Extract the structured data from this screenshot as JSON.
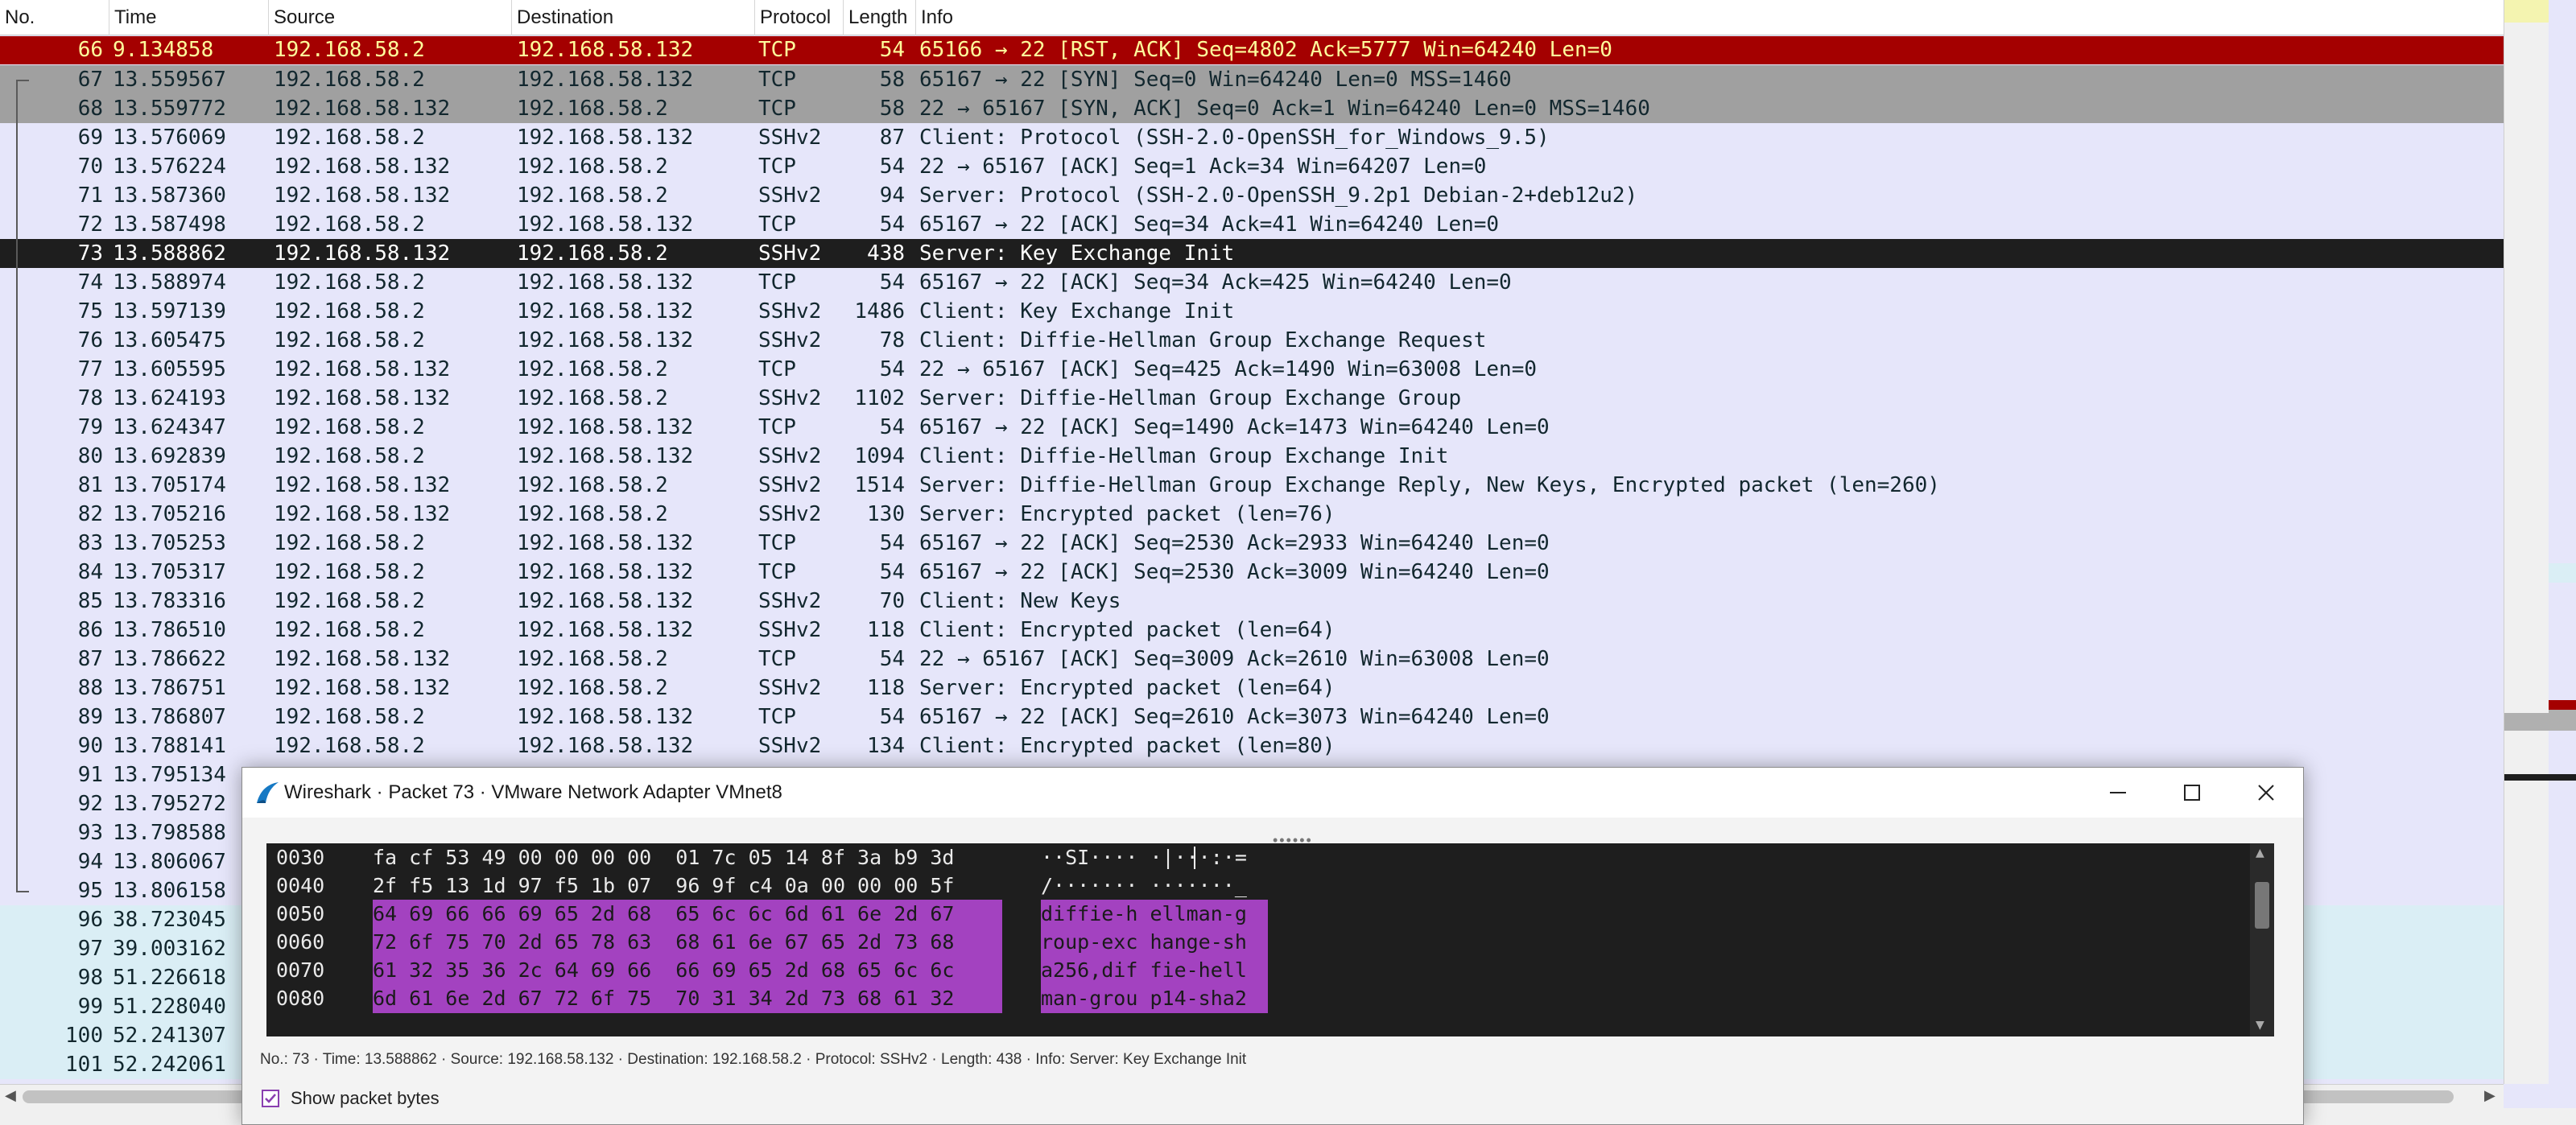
{
  "columns": [
    "No.",
    "Time",
    "Source",
    "Destination",
    "Protocol",
    "Length",
    "Info"
  ],
  "colors": {
    "row_default": "#e6e6fa",
    "row_rst": "#a40000",
    "row_syn": "#a0a0a0",
    "row_selected": "#1e1e1e",
    "row_later": "#daeef5",
    "hex_highlight": "#a342c0"
  },
  "packets": [
    {
      "no": "66",
      "time": "9.134858",
      "src": "192.168.58.2",
      "dst": "192.168.58.132",
      "proto": "TCP",
      "len": "54",
      "info": "65166 → 22 [RST, ACK] Seq=4802 Ack=5777 Win=64240 Len=0",
      "style": "rst"
    },
    {
      "no": "67",
      "time": "13.559567",
      "src": "192.168.58.2",
      "dst": "192.168.58.132",
      "proto": "TCP",
      "len": "58",
      "info": "65167 → 22 [SYN] Seq=0 Win=64240 Len=0 MSS=1460",
      "style": "syn"
    },
    {
      "no": "68",
      "time": "13.559772",
      "src": "192.168.58.132",
      "dst": "192.168.58.2",
      "proto": "TCP",
      "len": "58",
      "info": "22 → 65167 [SYN, ACK] Seq=0 Ack=1 Win=64240 Len=0 MSS=1460",
      "style": "syn"
    },
    {
      "no": "69",
      "time": "13.576069",
      "src": "192.168.58.2",
      "dst": "192.168.58.132",
      "proto": "SSHv2",
      "len": "87",
      "info": "Client: Protocol (SSH-2.0-OpenSSH_for_Windows_9.5)",
      "style": "normal"
    },
    {
      "no": "70",
      "time": "13.576224",
      "src": "192.168.58.132",
      "dst": "192.168.58.2",
      "proto": "TCP",
      "len": "54",
      "info": "22 → 65167 [ACK] Seq=1 Ack=34 Win=64207 Len=0",
      "style": "normal"
    },
    {
      "no": "71",
      "time": "13.587360",
      "src": "192.168.58.132",
      "dst": "192.168.58.2",
      "proto": "SSHv2",
      "len": "94",
      "info": "Server: Protocol (SSH-2.0-OpenSSH_9.2p1 Debian-2+deb12u2)",
      "style": "normal"
    },
    {
      "no": "72",
      "time": "13.587498",
      "src": "192.168.58.2",
      "dst": "192.168.58.132",
      "proto": "TCP",
      "len": "54",
      "info": "65167 → 22 [ACK] Seq=34 Ack=41 Win=64240 Len=0",
      "style": "normal"
    },
    {
      "no": "73",
      "time": "13.588862",
      "src": "192.168.58.132",
      "dst": "192.168.58.2",
      "proto": "SSHv2",
      "len": "438",
      "info": "Server: Key Exchange Init",
      "style": "selected"
    },
    {
      "no": "74",
      "time": "13.588974",
      "src": "192.168.58.2",
      "dst": "192.168.58.132",
      "proto": "TCP",
      "len": "54",
      "info": "65167 → 22 [ACK] Seq=34 Ack=425 Win=64240 Len=0",
      "style": "normal"
    },
    {
      "no": "75",
      "time": "13.597139",
      "src": "192.168.58.2",
      "dst": "192.168.58.132",
      "proto": "SSHv2",
      "len": "1486",
      "info": "Client: Key Exchange Init",
      "style": "normal"
    },
    {
      "no": "76",
      "time": "13.605475",
      "src": "192.168.58.2",
      "dst": "192.168.58.132",
      "proto": "SSHv2",
      "len": "78",
      "info": "Client: Diffie-Hellman Group Exchange Request",
      "style": "normal"
    },
    {
      "no": "77",
      "time": "13.605595",
      "src": "192.168.58.132",
      "dst": "192.168.58.2",
      "proto": "TCP",
      "len": "54",
      "info": "22 → 65167 [ACK] Seq=425 Ack=1490 Win=63008 Len=0",
      "style": "normal"
    },
    {
      "no": "78",
      "time": "13.624193",
      "src": "192.168.58.132",
      "dst": "192.168.58.2",
      "proto": "SSHv2",
      "len": "1102",
      "info": "Server: Diffie-Hellman Group Exchange Group",
      "style": "normal"
    },
    {
      "no": "79",
      "time": "13.624347",
      "src": "192.168.58.2",
      "dst": "192.168.58.132",
      "proto": "TCP",
      "len": "54",
      "info": "65167 → 22 [ACK] Seq=1490 Ack=1473 Win=64240 Len=0",
      "style": "normal"
    },
    {
      "no": "80",
      "time": "13.692839",
      "src": "192.168.58.2",
      "dst": "192.168.58.132",
      "proto": "SSHv2",
      "len": "1094",
      "info": "Client: Diffie-Hellman Group Exchange Init",
      "style": "normal"
    },
    {
      "no": "81",
      "time": "13.705174",
      "src": "192.168.58.132",
      "dst": "192.168.58.2",
      "proto": "SSHv2",
      "len": "1514",
      "info": "Server: Diffie-Hellman Group Exchange Reply, New Keys, Encrypted packet (len=260)",
      "style": "normal"
    },
    {
      "no": "82",
      "time": "13.705216",
      "src": "192.168.58.132",
      "dst": "192.168.58.2",
      "proto": "SSHv2",
      "len": "130",
      "info": "Server: Encrypted packet (len=76)",
      "style": "normal"
    },
    {
      "no": "83",
      "time": "13.705253",
      "src": "192.168.58.2",
      "dst": "192.168.58.132",
      "proto": "TCP",
      "len": "54",
      "info": "65167 → 22 [ACK] Seq=2530 Ack=2933 Win=64240 Len=0",
      "style": "normal"
    },
    {
      "no": "84",
      "time": "13.705317",
      "src": "192.168.58.2",
      "dst": "192.168.58.132",
      "proto": "TCP",
      "len": "54",
      "info": "65167 → 22 [ACK] Seq=2530 Ack=3009 Win=64240 Len=0",
      "style": "normal"
    },
    {
      "no": "85",
      "time": "13.783316",
      "src": "192.168.58.2",
      "dst": "192.168.58.132",
      "proto": "SSHv2",
      "len": "70",
      "info": "Client: New Keys",
      "style": "normal"
    },
    {
      "no": "86",
      "time": "13.786510",
      "src": "192.168.58.2",
      "dst": "192.168.58.132",
      "proto": "SSHv2",
      "len": "118",
      "info": "Client: Encrypted packet (len=64)",
      "style": "normal"
    },
    {
      "no": "87",
      "time": "13.786622",
      "src": "192.168.58.132",
      "dst": "192.168.58.2",
      "proto": "TCP",
      "len": "54",
      "info": "22 → 65167 [ACK] Seq=3009 Ack=2610 Win=63008 Len=0",
      "style": "normal"
    },
    {
      "no": "88",
      "time": "13.786751",
      "src": "192.168.58.132",
      "dst": "192.168.58.2",
      "proto": "SSHv2",
      "len": "118",
      "info": "Server: Encrypted packet (len=64)",
      "style": "normal"
    },
    {
      "no": "89",
      "time": "13.786807",
      "src": "192.168.58.2",
      "dst": "192.168.58.132",
      "proto": "TCP",
      "len": "54",
      "info": "65167 → 22 [ACK] Seq=2610 Ack=3073 Win=64240 Len=0",
      "style": "normal"
    },
    {
      "no": "90",
      "time": "13.788141",
      "src": "192.168.58.2",
      "dst": "192.168.58.132",
      "proto": "SSHv2",
      "len": "134",
      "info": "Client: Encrypted packet (len=80)",
      "style": "normal"
    },
    {
      "no": "91",
      "time": "13.795134",
      "src": "",
      "dst": "",
      "proto": "",
      "len": "",
      "info": "",
      "style": "normal"
    },
    {
      "no": "92",
      "time": "13.795272",
      "src": "",
      "dst": "",
      "proto": "",
      "len": "",
      "info": "",
      "style": "normal"
    },
    {
      "no": "93",
      "time": "13.798588",
      "src": "",
      "dst": "",
      "proto": "",
      "len": "",
      "info": "",
      "style": "normal"
    },
    {
      "no": "94",
      "time": "13.806067",
      "src": "",
      "dst": "",
      "proto": "",
      "len": "",
      "info": "",
      "style": "normal"
    },
    {
      "no": "95",
      "time": "13.806158",
      "src": "",
      "dst": "",
      "proto": "",
      "len": "",
      "info": "",
      "style": "normal"
    },
    {
      "no": "96",
      "time": "38.723045",
      "src": "",
      "dst": "",
      "proto": "",
      "len": "",
      "info": "",
      "style": "later"
    },
    {
      "no": "97",
      "time": "39.003162",
      "src": "",
      "dst": "",
      "proto": "",
      "len": "",
      "info": "",
      "style": "later"
    },
    {
      "no": "98",
      "time": "51.226618",
      "src": "",
      "dst": "",
      "proto": "",
      "len": "",
      "info": "",
      "style": "later"
    },
    {
      "no": "99",
      "time": "51.228040",
      "src": "",
      "dst": "",
      "proto": "",
      "len": "",
      "info": "",
      "style": "later"
    },
    {
      "no": "100",
      "time": "52.241307",
      "src": "",
      "dst": "",
      "proto": "",
      "len": "",
      "info": "",
      "style": "later"
    },
    {
      "no": "101",
      "time": "52.242061",
      "src": "",
      "dst": "",
      "proto": "",
      "len": "",
      "info": "",
      "style": "later"
    }
  ],
  "popup": {
    "title": "Wireshark · Packet 73 · VMware Network Adapter VMnet8",
    "status": "No.: 73 · Time: 13.588862 · Source: 192.168.58.132 · Destination: 192.168.58.2 · Protocol: SSHv2 · Length: 438 · Info: Server: Key Exchange Init",
    "show_bytes_label": "Show packet bytes",
    "show_bytes_checked": true,
    "hex_rows": [
      {
        "offset": "0030",
        "bytes": "fa cf 53 49 00 00 00 00  01 7c 05 14 8f 3a b9 3d",
        "ascii": "··SI···· ·|···:·=",
        "selected": false
      },
      {
        "offset": "0040",
        "bytes": "2f f5 13 1d 97 f5 1b 07  96 9f c4 0a 00 00 00 5f",
        "ascii": "/······· ·······_",
        "selected": false
      },
      {
        "offset": "0050",
        "bytes": "64 69 66 66 69 65 2d 68  65 6c 6c 6d 61 6e 2d 67",
        "ascii": "diffie-h ellman-g",
        "selected": true
      },
      {
        "offset": "0060",
        "bytes": "72 6f 75 70 2d 65 78 63  68 61 6e 67 65 2d 73 68",
        "ascii": "roup-exc hange-sh",
        "selected": true
      },
      {
        "offset": "0070",
        "bytes": "61 32 35 36 2c 64 69 66  66 69 65 2d 68 65 6c 6c",
        "ascii": "a256,dif fie-hell",
        "selected": true
      },
      {
        "offset": "0080",
        "bytes": "6d 61 6e 2d 67 72 6f 75  70 31 34 2d 73 68 61 32",
        "ascii": "man-grou p14-sha2",
        "selected": true
      }
    ]
  }
}
